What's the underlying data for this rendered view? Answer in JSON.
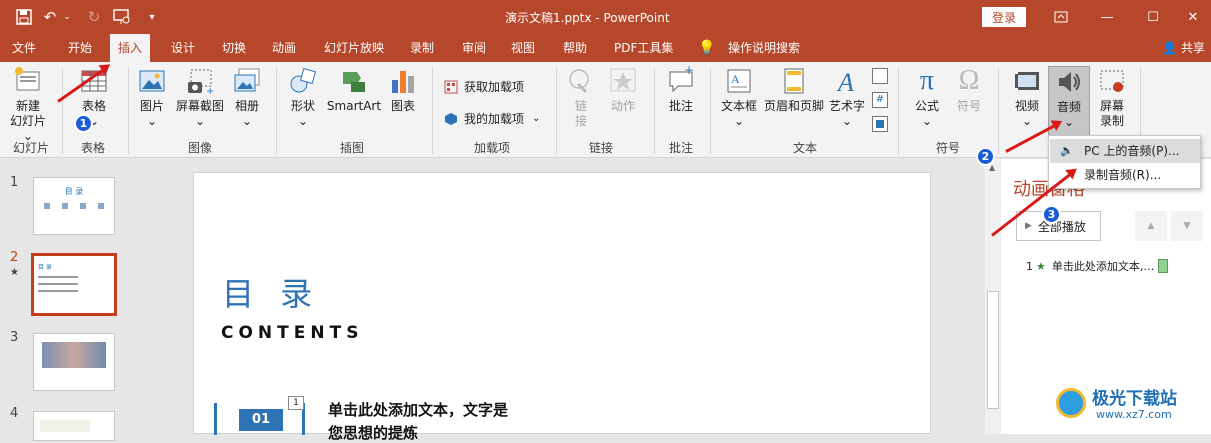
{
  "window": {
    "title": "演示文稿1.pptx - PowerPoint",
    "login_label": "登录"
  },
  "tabs": [
    "文件",
    "开始",
    "插入",
    "设计",
    "切换",
    "动画",
    "幻灯片放映",
    "录制",
    "审阅",
    "视图",
    "帮助",
    "PDF工具集"
  ],
  "active_tab": "插入",
  "tell_me": "操作说明搜索",
  "share_label": "共享",
  "ribbon": {
    "new_slide": "新建\n幻灯片",
    "new_slide_l1": "新建",
    "new_slide_l2": "幻灯片 ⌄",
    "table": "表格",
    "picture": "图片",
    "screenshot": "屏幕截图",
    "album": "相册",
    "shapes": "形状",
    "smartart": "SmartArt",
    "chart": "图表",
    "get_addins": "获取加载项",
    "my_addins": "我的加载项",
    "link": "链接",
    "link_l1": "链",
    "link_l2": "接",
    "action": "动作",
    "comment": "批注",
    "textbox": "文本框",
    "header_footer": "页眉和页脚",
    "wordart": "艺术字",
    "equation": "公式",
    "symbol": "符号",
    "video": "视频",
    "audio": "音频",
    "screen_rec_l1": "屏幕",
    "screen_rec_l2": "录制",
    "groups": {
      "slides": "幻灯片",
      "tables": "表格",
      "images": "图像",
      "illustrations": "插图",
      "addins": "加载项",
      "links": "链接",
      "comments": "批注",
      "text": "文本",
      "symbols": "符号"
    }
  },
  "audio_menu": {
    "item1": "PC 上的音频(P)...",
    "item2": "录制音频(R)..."
  },
  "thumbnails": {
    "nums": [
      "1",
      "2",
      "3",
      "4"
    ],
    "star": "★",
    "t1_title": "目 录",
    "t2_title": "目 录"
  },
  "slide": {
    "title": "目 录",
    "subtitle": "CONTENTS",
    "item_num": "01",
    "item_text_l1": "单击此处添加文本，文字是",
    "item_text_l2": "您思想的提炼",
    "anim_marker": "1"
  },
  "anim_pane": {
    "title": "动画窗格",
    "play_all": "全部播放",
    "item_num": "1",
    "item_text": "单击此处添加文本,…"
  },
  "badges": [
    "1",
    "2",
    "3"
  ],
  "watermark": {
    "name": "极光下载站",
    "url": "www.xz7.com"
  },
  "colors": {
    "accent": "#b7472a",
    "slide_blue": "#2e74b5",
    "badge_blue": "#1a5bd6",
    "arrow_red": "#d71b1b"
  }
}
